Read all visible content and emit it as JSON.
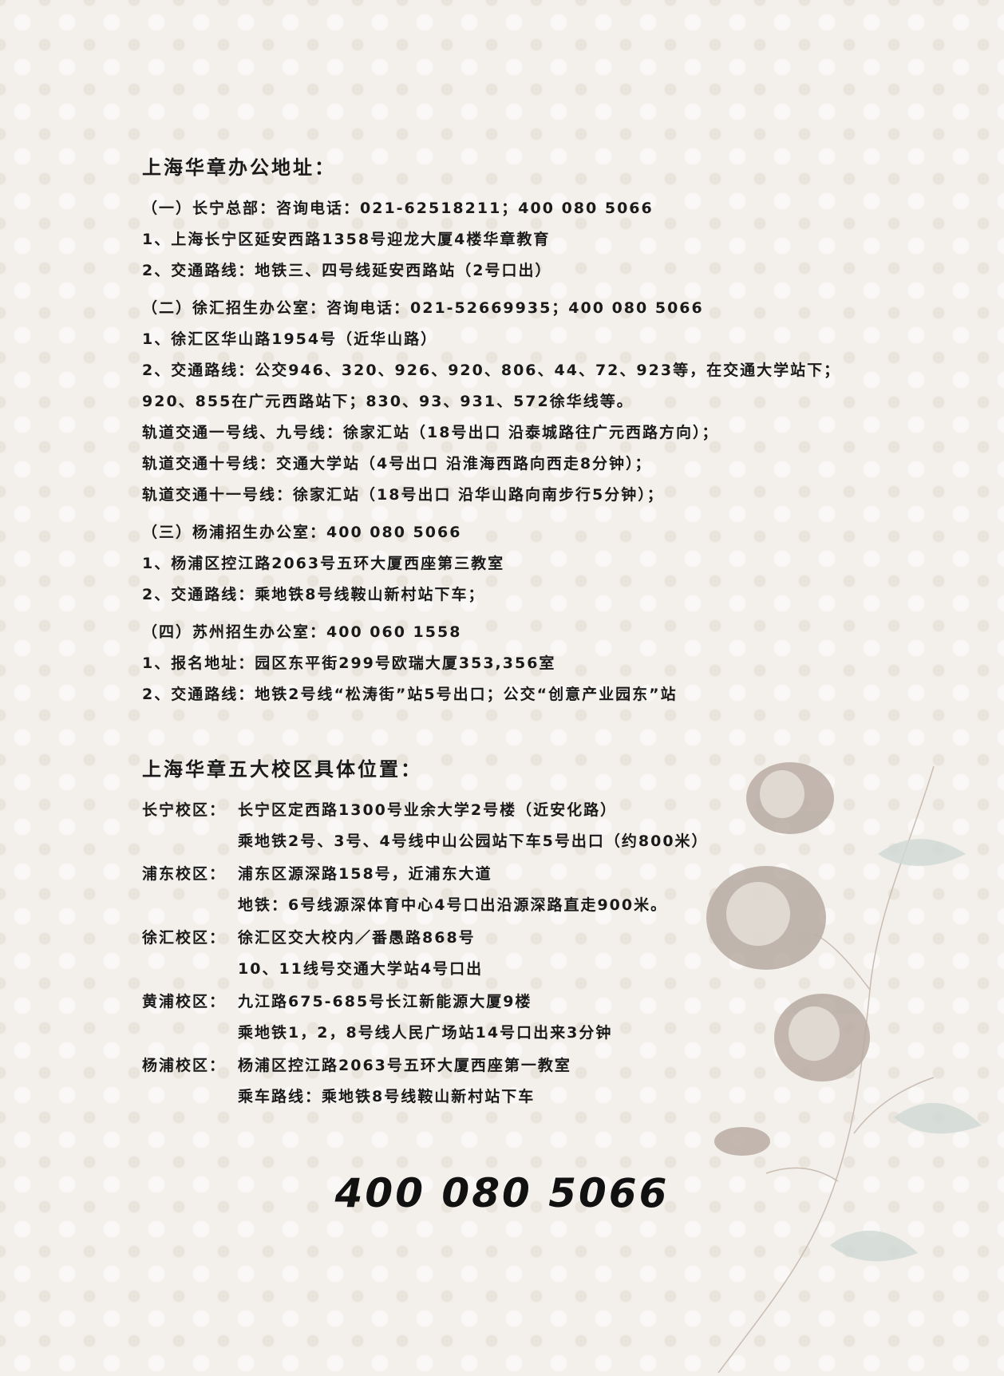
{
  "offices": {
    "title": "上海华章办公地址：",
    "groups": [
      {
        "head": "（一）长宁总部：咨询电话：021-62518211；400 080 5066",
        "lines": [
          "1、上海长宁区延安西路1358号迎龙大厦4楼华章教育",
          "2、交通路线：地铁三、四号线延安西路站（2号口出）"
        ]
      },
      {
        "head": "（二）徐汇招生办公室：咨询电话：021-52669935；400 080 5066",
        "lines": [
          "1、徐汇区华山路1954号（近华山路）",
          "2、交通路线：公交946、320、926、920、806、44、72、923等，在交通大学站下；",
          "920、855在广元西路站下；830、93、931、572徐华线等。",
          "轨道交通一号线、九号线：徐家汇站（18号出口 沿泰城路往广元西路方向）；",
          "轨道交通十号线：交通大学站（4号出口 沿淮海西路向西走8分钟）；",
          "轨道交通十一号线：徐家汇站（18号出口 沿华山路向南步行5分钟）；"
        ]
      },
      {
        "head": "（三）杨浦招生办公室：400 080 5066",
        "lines": [
          "1、杨浦区控江路2063号五环大厦西座第三教室",
          "2、交通路线：乘地铁8号线鞍山新村站下车；"
        ]
      },
      {
        "head": "（四）苏州招生办公室：400 060 1558",
        "lines": [
          "1、报名地址：园区东平街299号欧瑞大厦353,356室",
          "2、交通路线：地铁2号线“松涛街”站5号出口；公交“创意产业园东”站"
        ]
      }
    ]
  },
  "campuses": {
    "title": "上海华章五大校区具体位置：",
    "items": [
      {
        "label": "长宁校区：",
        "lines": [
          "长宁区定西路1300号业余大学2号楼（近安化路）",
          "乘地铁2号、3号、4号线中山公园站下车5号出口（约800米）"
        ]
      },
      {
        "label": "浦东校区：",
        "lines": [
          "浦东区源深路158号，近浦东大道",
          "地铁：6号线源深体育中心4号口出沿源深路直走900米。"
        ]
      },
      {
        "label": "徐汇校区：",
        "lines": [
          "徐汇区交大校内／番愚路868号",
          "10、11线号交通大学站4号口出"
        ]
      },
      {
        "label": "黄浦校区：",
        "lines": [
          "九江路675-685号长江新能源大厦9楼",
          "乘地铁1，2，8号线人民广场站14号口出来3分钟"
        ]
      },
      {
        "label": "杨浦校区：",
        "lines": [
          "杨浦区控江路2063号五环大厦西座第一教室",
          "乘车路线：乘地铁8号线鞍山新村站下车"
        ]
      }
    ]
  },
  "hotline": "400 080 5066"
}
